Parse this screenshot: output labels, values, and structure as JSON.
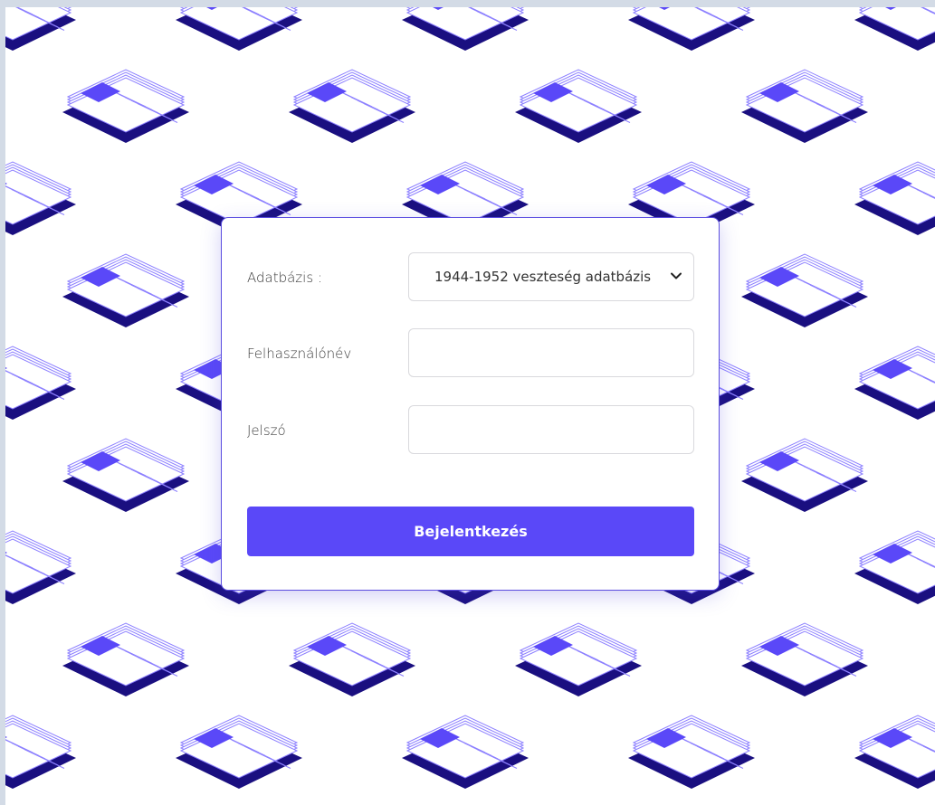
{
  "login_form": {
    "database_label": "Adatbázis :",
    "database_selected": "1944-1952 veszteség adatbázis",
    "username_label": "Felhasználónév",
    "username_value": "",
    "password_label": "Jelszó",
    "password_value": "",
    "submit_label": "Bejelentkezés"
  },
  "icons": {
    "background_tile": "document-stack-icon",
    "select_arrow": "chevron-down-icon"
  },
  "colors": {
    "accent": "#5a48f8",
    "background_tint": "#d3dbe6",
    "pattern_dark": "#1a0f80",
    "pattern_line": "#8d80ff"
  }
}
